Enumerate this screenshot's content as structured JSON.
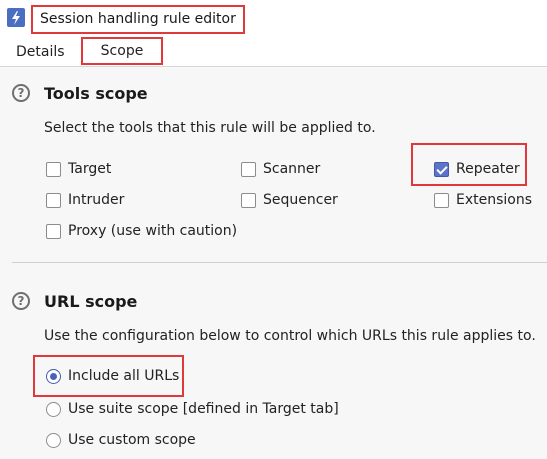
{
  "window": {
    "title": "Session handling rule editor",
    "icon": "lightning-app-icon"
  },
  "tabs": [
    {
      "label": "Details",
      "active": false
    },
    {
      "label": "Scope",
      "active": true
    }
  ],
  "tools_scope": {
    "title": "Tools scope",
    "description": "Select the tools that this rule will be applied to.",
    "tools": [
      {
        "label": "Target",
        "checked": false
      },
      {
        "label": "Scanner",
        "checked": false
      },
      {
        "label": "Repeater",
        "checked": true
      },
      {
        "label": "Intruder",
        "checked": false
      },
      {
        "label": "Sequencer",
        "checked": false
      },
      {
        "label": "Extensions",
        "checked": false
      },
      {
        "label": "Proxy (use with caution)",
        "checked": false
      }
    ]
  },
  "url_scope": {
    "title": "URL scope",
    "description": "Use the configuration below to control which URLs this rule applies to.",
    "options": [
      {
        "label": "Include all URLs",
        "selected": true
      },
      {
        "label": "Use suite scope [defined in Target tab]",
        "selected": false
      },
      {
        "label": "Use custom scope",
        "selected": false
      }
    ]
  },
  "colors": {
    "highlight": "#e0393b",
    "accent": "#5b74c8",
    "panel_bg": "#f7f7f7"
  }
}
